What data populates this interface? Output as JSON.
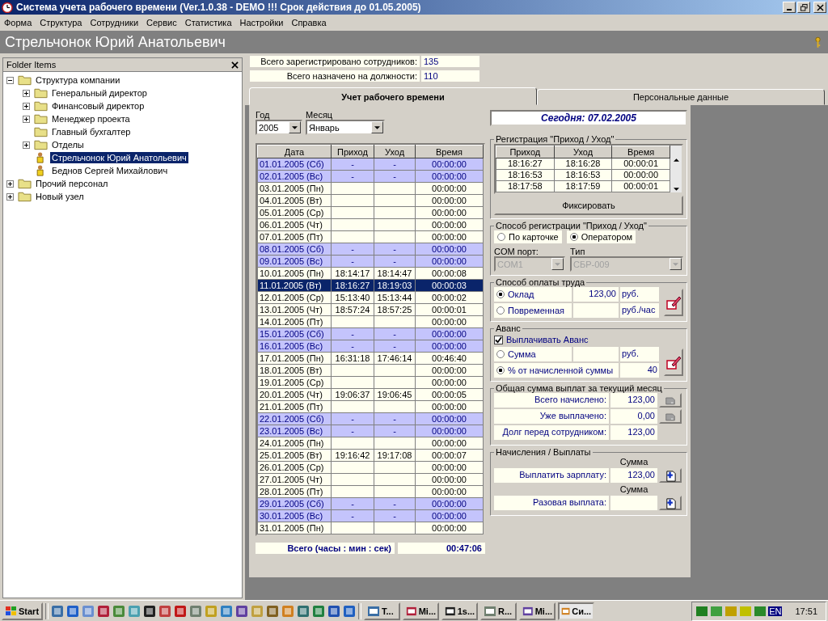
{
  "window": {
    "title": "Система учета рабочего времени (Ver.1.0.38 - DEMO !!! Срок действия до 01.05.2005)"
  },
  "menu": [
    "Форма",
    "Структура",
    "Сотрудники",
    "Сервис",
    "Статистика",
    "Настройки",
    "Справка"
  ],
  "header": {
    "title": "Стрельчонок Юрий Анатольевич"
  },
  "folder_panel": {
    "title": "Folder Items",
    "tree": [
      {
        "label": "Структура компании",
        "kind": "folder",
        "expanded": true,
        "selected": false,
        "children": [
          {
            "label": "Генеральный директор",
            "kind": "folder",
            "expanded": false,
            "selected": false
          },
          {
            "label": "Финансовый директор",
            "kind": "folder",
            "expanded": false,
            "selected": false
          },
          {
            "label": "Менеджер проекта",
            "kind": "folder",
            "expanded": false,
            "selected": false
          },
          {
            "label": "Главный бухгалтер",
            "kind": "folder",
            "selected": false
          },
          {
            "label": "Отделы",
            "kind": "folder",
            "expanded": false,
            "selected": false
          },
          {
            "label": "Стрельчонок Юрий Анатольевич",
            "kind": "person",
            "selected": true
          },
          {
            "label": "Беднов Сергей Михайлович",
            "kind": "person",
            "selected": false
          }
        ]
      },
      {
        "label": "Прочий персонал",
        "kind": "folder",
        "expanded": false,
        "selected": false
      },
      {
        "label": "Новый узел",
        "kind": "folder",
        "expanded": false,
        "selected": false
      }
    ]
  },
  "stats": [
    {
      "label": "Всего зарегистрировано сотрудников:",
      "value": "135"
    },
    {
      "label": "Всего назначено на должности:",
      "value": "110"
    }
  ],
  "tabs": [
    {
      "label": "Учет рабочего времени",
      "selected": true
    },
    {
      "label": "Персональные данные",
      "selected": false
    }
  ],
  "year": {
    "label": "Год",
    "value": "2005"
  },
  "month": {
    "label": "Месяц",
    "value": "Январь"
  },
  "table": {
    "columns": [
      "Дата",
      "Приход",
      "Уход",
      "Время"
    ],
    "rows": [
      {
        "date": "01.01.2005 (Сб)",
        "in": "-",
        "out": "-",
        "time": "00:00:00",
        "kind": "weekend",
        "selected": false
      },
      {
        "date": "02.01.2005 (Вс)",
        "in": "-",
        "out": "-",
        "time": "00:00:00",
        "kind": "weekend",
        "selected": false
      },
      {
        "date": "03.01.2005 (Пн)",
        "time": "00:00:00",
        "kind": "workday",
        "selected": false
      },
      {
        "date": "04.01.2005 (Вт)",
        "time": "00:00:00",
        "kind": "workday",
        "selected": false
      },
      {
        "date": "05.01.2005 (Ср)",
        "time": "00:00:00",
        "kind": "workday",
        "selected": false
      },
      {
        "date": "06.01.2005 (Чт)",
        "time": "00:00:00",
        "kind": "workday",
        "selected": false
      },
      {
        "date": "07.01.2005 (Пт)",
        "time": "00:00:00",
        "kind": "workday",
        "selected": false
      },
      {
        "date": "08.01.2005 (Сб)",
        "in": "-",
        "out": "-",
        "time": "00:00:00",
        "kind": "weekend",
        "selected": false
      },
      {
        "date": "09.01.2005 (Вс)",
        "in": "-",
        "out": "-",
        "time": "00:00:00",
        "kind": "weekend",
        "selected": false
      },
      {
        "date": "10.01.2005 (Пн)",
        "in": "18:14:17",
        "out": "18:14:47",
        "time": "00:00:08",
        "kind": "workday",
        "selected": false
      },
      {
        "date": "11.01.2005 (Вт)",
        "in": "18:16:27",
        "out": "18:19:03",
        "time": "00:00:03",
        "kind": "workday",
        "selected": true
      },
      {
        "date": "12.01.2005 (Ср)",
        "in": "15:13:40",
        "out": "15:13:44",
        "time": "00:00:02",
        "kind": "workday",
        "selected": false
      },
      {
        "date": "13.01.2005 (Чт)",
        "in": "18:57:24",
        "out": "18:57:25",
        "time": "00:00:01",
        "kind": "workday",
        "selected": false
      },
      {
        "date": "14.01.2005 (Пт)",
        "time": "00:00:00",
        "kind": "workday",
        "selected": false
      },
      {
        "date": "15.01.2005 (Сб)",
        "in": "-",
        "out": "-",
        "time": "00:00:00",
        "kind": "weekend",
        "selected": false
      },
      {
        "date": "16.01.2005 (Вс)",
        "in": "-",
        "out": "-",
        "time": "00:00:00",
        "kind": "weekend",
        "selected": false
      },
      {
        "date": "17.01.2005 (Пн)",
        "in": "16:31:18",
        "out": "17:46:14",
        "time": "00:46:40",
        "kind": "workday",
        "selected": false
      },
      {
        "date": "18.01.2005 (Вт)",
        "time": "00:00:00",
        "kind": "workday",
        "selected": false
      },
      {
        "date": "19.01.2005 (Ср)",
        "time": "00:00:00",
        "kind": "workday",
        "selected": false
      },
      {
        "date": "20.01.2005 (Чт)",
        "in": "19:06:37",
        "out": "19:06:45",
        "time": "00:00:05",
        "kind": "workday",
        "selected": false
      },
      {
        "date": "21.01.2005 (Пт)",
        "time": "00:00:00",
        "kind": "workday",
        "selected": false
      },
      {
        "date": "22.01.2005 (Сб)",
        "in": "-",
        "out": "-",
        "time": "00:00:00",
        "kind": "weekend",
        "selected": false
      },
      {
        "date": "23.01.2005 (Вс)",
        "in": "-",
        "out": "-",
        "time": "00:00:00",
        "kind": "weekend",
        "selected": false
      },
      {
        "date": "24.01.2005 (Пн)",
        "time": "00:00:00",
        "kind": "workday",
        "selected": false
      },
      {
        "date": "25.01.2005 (Вт)",
        "in": "19:16:42",
        "out": "19:17:08",
        "time": "00:00:07",
        "kind": "workday",
        "selected": false
      },
      {
        "date": "26.01.2005 (Ср)",
        "time": "00:00:00",
        "kind": "workday",
        "selected": false
      },
      {
        "date": "27.01.2005 (Чт)",
        "time": "00:00:00",
        "kind": "workday",
        "selected": false
      },
      {
        "date": "28.01.2005 (Пт)",
        "time": "00:00:00",
        "kind": "workday",
        "selected": false
      },
      {
        "date": "29.01.2005 (Сб)",
        "in": "-",
        "out": "-",
        "time": "00:00:00",
        "kind": "weekend",
        "selected": false
      },
      {
        "date": "30.01.2005 (Вс)",
        "in": "-",
        "out": "-",
        "time": "00:00:00",
        "kind": "weekend",
        "selected": false
      },
      {
        "date": "31.01.2005 (Пн)",
        "time": "00:00:00",
        "kind": "workday",
        "selected": false
      }
    ],
    "total": {
      "label": "Всего (часы : мин : сек)",
      "value": "00:47:06"
    }
  },
  "today": "Сегодня: 07.02.2005",
  "registration": {
    "title": "Регистрация \"Приход / Уход\"",
    "columns": [
      "Приход",
      "Уход",
      "Время"
    ],
    "rows": [
      [
        "18:16:27",
        "18:16:28",
        "00:00:01"
      ],
      [
        "18:16:53",
        "18:16:53",
        "00:00:00"
      ],
      [
        "18:17:58",
        "18:17:59",
        "00:00:01"
      ]
    ],
    "button": "Фиксировать"
  },
  "reg_method": {
    "title": "Способ регистрации \"Приход / Уход\"",
    "options": [
      {
        "label": "По карточке",
        "selected": false
      },
      {
        "label": "Оператором",
        "selected": true
      }
    ],
    "port": {
      "label": "COM порт:",
      "value": "COM1",
      "disabled": true
    },
    "type": {
      "label": "Тип",
      "value": "СБР-009",
      "disabled": true
    }
  },
  "pay": {
    "title": "Способ оплаты труда",
    "options": [
      {
        "label": "Оклад",
        "selected": true,
        "value": "123,00",
        "unit": "руб."
      },
      {
        "label": "Повременная",
        "selected": false,
        "unit": "руб./час"
      }
    ]
  },
  "advance": {
    "title": "Аванс",
    "checkbox": {
      "label": "Выплачивать Аванс",
      "checked": true
    },
    "options": [
      {
        "label": "Сумма",
        "selected": false,
        "unit": "руб."
      },
      {
        "label": "% от начисленной суммы",
        "selected": true,
        "value": "40"
      }
    ]
  },
  "totals": {
    "title": "Общая сумма выплат за текущий месяц",
    "rows": [
      {
        "label": "Всего начислено:",
        "value": "123,00",
        "kind": "with-button"
      },
      {
        "label": "Уже выплачено:",
        "value": "0,00",
        "kind": "with-button"
      },
      {
        "label": "Долг перед сотрудником:",
        "value": "123,00",
        "kind": "plain"
      }
    ]
  },
  "payments": {
    "title": "Начисления / Выплаты",
    "rows": [
      {
        "heading": "Сумма",
        "label": "Выплатить зарплату:",
        "value": "123,00"
      },
      {
        "heading": "Сумма",
        "label": "Разовая выплата:"
      }
    ]
  },
  "taskbar": {
    "start": "Start",
    "tasks": [
      {
        "label": "T...",
        "selected": false
      },
      {
        "label": "Mi...",
        "selected": false
      },
      {
        "label": "1s...",
        "selected": false
      },
      {
        "label": "R...",
        "selected": false
      },
      {
        "label": "Mi...",
        "selected": false
      },
      {
        "label": "Си...",
        "selected": true
      }
    ],
    "language": "EN",
    "time": "17:51"
  }
}
